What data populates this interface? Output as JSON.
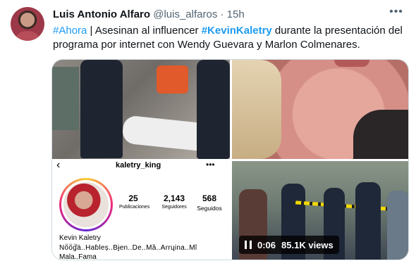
{
  "tweet": {
    "author_name": "Luis Antonio Alfaro",
    "handle": "@luis_alfaros",
    "separator": "·",
    "time": "15h",
    "text_parts": {
      "tag1": "#Ahora",
      "seg1": " | Asesinan al influencer ",
      "tag2": "#KevinKaletry",
      "seg2": " durante la presentación del programa por internet con Wendy Guevara y Marlon Colmenares."
    },
    "more_icon": "more-horizontal-icon"
  },
  "media": {
    "profile": {
      "back_icon": "chevron-left-icon",
      "username": "kaletry_king",
      "more_icon": "more-horizontal-icon",
      "stats": [
        {
          "value": "25",
          "label": "Publicaciones"
        },
        {
          "value": "2,143",
          "label": "Seguidores"
        },
        {
          "value": "568",
          "label": "Seguidos"
        }
      ],
      "display_name": "Kevin Kaletry",
      "bio_line1": "Nö̈ö̈ɠ̈ä..Haɓleș..Bɉen..De..Mȁ..Arrɥina..Mǐ",
      "bio_line2": "Mala..Fama"
    },
    "video": {
      "pause_icon": "pause-icon",
      "duration": "0:06",
      "views": "85.1K views"
    }
  },
  "colors": {
    "link": "#1d9bf0",
    "text": "#0f1419",
    "secondary": "#536471",
    "border": "#cfd9de"
  }
}
